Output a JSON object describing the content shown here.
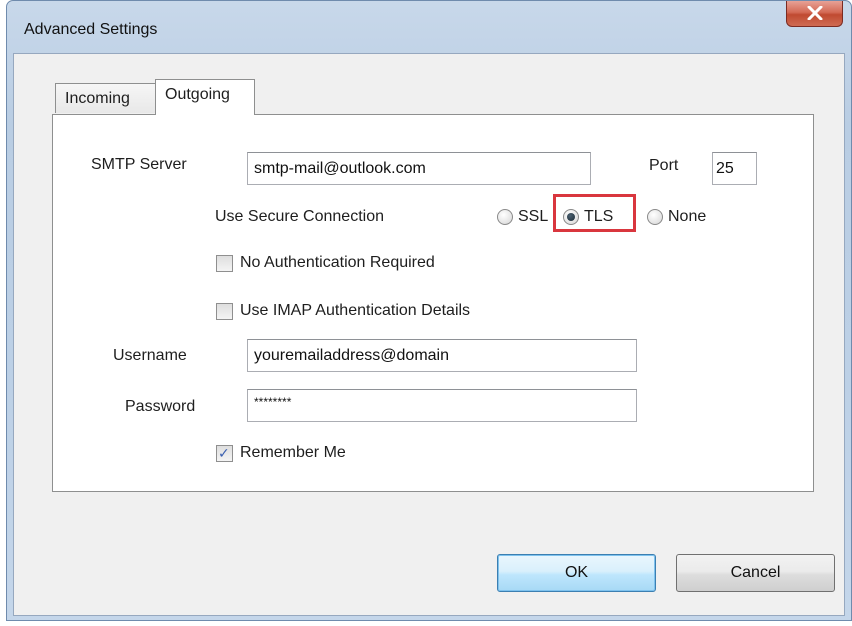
{
  "window": {
    "title": "Advanced Settings"
  },
  "tabs": [
    {
      "label": "Incoming",
      "selected": false
    },
    {
      "label": "Outgoing",
      "selected": true
    }
  ],
  "outgoing": {
    "smtp_server_label": "SMTP Server",
    "smtp_server_value": "smtp-mail@outlook.com",
    "port_label": "Port",
    "port_value": "25",
    "secure_connection_label": "Use Secure Connection",
    "secure_options": [
      {
        "label": "SSL",
        "selected": false
      },
      {
        "label": "TLS",
        "selected": true
      },
      {
        "label": "None",
        "selected": false
      }
    ],
    "no_auth_label": "No Authentication Required",
    "no_auth_checked": false,
    "use_imap_auth_label": "Use IMAP Authentication Details",
    "use_imap_auth_checked": false,
    "username_label": "Username",
    "username_value": "youremailaddress@domain",
    "password_label": "Password",
    "password_value": "********",
    "remember_me_label": "Remember Me",
    "remember_me_checked": true
  },
  "buttons": {
    "ok_label": "OK",
    "cancel_label": "Cancel"
  },
  "colors": {
    "highlight": "#d9363e",
    "close_button": "#c7533b"
  },
  "icons": {
    "close": "close-icon",
    "checkmark": "checkmark-icon"
  }
}
